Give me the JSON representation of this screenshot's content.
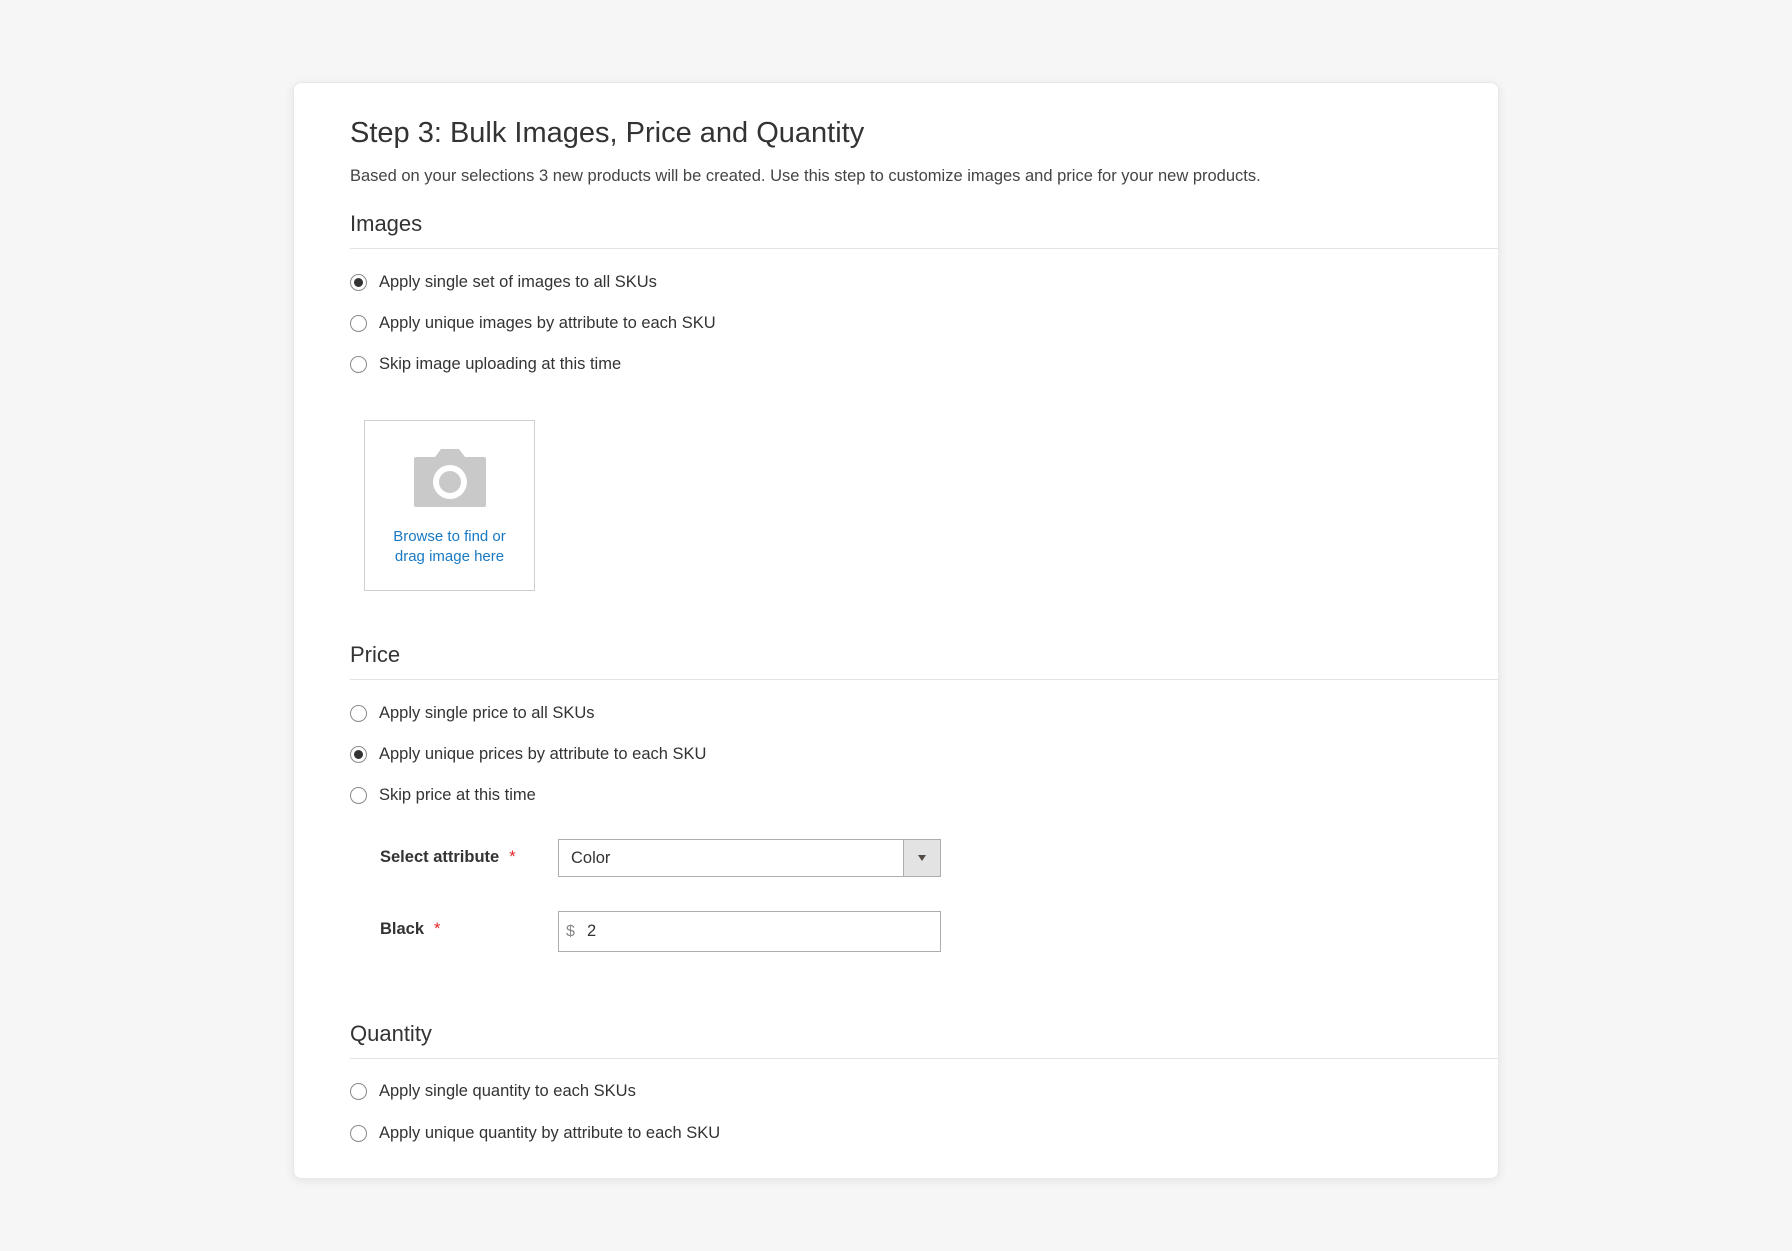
{
  "step": {
    "title": "Step 3: Bulk Images, Price and Quantity",
    "description": "Based on your selections 3 new products will be created. Use this step to customize images and price for your new products."
  },
  "images": {
    "heading": "Images",
    "options": [
      {
        "label": "Apply single set of images to all SKUs",
        "checked": true
      },
      {
        "label": "Apply unique images by attribute to each SKU",
        "checked": false
      },
      {
        "label": "Skip image uploading at this time",
        "checked": false
      }
    ],
    "upload": {
      "line1": "Browse to find or",
      "line2": "drag image here",
      "icon": "camera-icon"
    }
  },
  "price": {
    "heading": "Price",
    "options": [
      {
        "label": "Apply single price to all SKUs",
        "checked": false
      },
      {
        "label": "Apply unique prices by attribute to each SKU",
        "checked": true
      },
      {
        "label": "Skip price at this time",
        "checked": false
      }
    ],
    "select_attribute": {
      "label": "Select attribute",
      "required_mark": "*",
      "value": "Color"
    },
    "black": {
      "label": "Black",
      "required_mark": "*",
      "currency": "$",
      "value": "2"
    }
  },
  "quantity": {
    "heading": "Quantity",
    "options": [
      {
        "label": "Apply single quantity to each SKUs",
        "checked": false
      },
      {
        "label": "Apply unique quantity by attribute to each SKU",
        "checked": false
      }
    ]
  },
  "colors": {
    "page_background": "#f6f6f6",
    "link": "#1979c3",
    "required": "#e22626",
    "text": "#333333"
  }
}
